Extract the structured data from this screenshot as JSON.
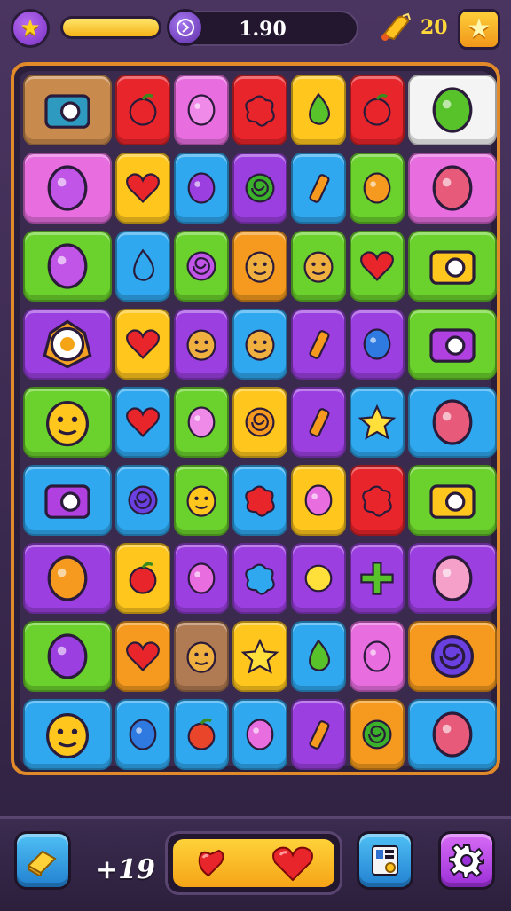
{
  "hud": {
    "score": "1.90",
    "lives": "20",
    "level_icon": "star-icon",
    "settings_icon": "gear-icon"
  },
  "bottom": {
    "moves": "19",
    "booster_icon": "eraser-icon",
    "map_icon": "map-icon",
    "tray_items": [
      "heart-piece",
      "heart"
    ]
  },
  "colors": {
    "green": "#6bd12c",
    "red": "#e8252b",
    "pink": "#e86ee0",
    "yellow": "#ffc61e",
    "blue": "#2fa8f0",
    "purple": "#9b3fe0",
    "orange": "#f59a1e",
    "white": "#f4f4f4",
    "tan": "#c98a4e",
    "brown": "#b07a52"
  },
  "board": {
    "rows": [
      [
        {
          "color": "tan",
          "icon": "map"
        },
        {
          "color": "red",
          "icon": "apple"
        },
        {
          "color": "pink",
          "icon": "blob"
        },
        {
          "color": "red",
          "icon": "flower"
        },
        {
          "color": "yellow",
          "icon": "green-drop"
        },
        {
          "color": "red",
          "icon": "apple"
        },
        {
          "color": "white",
          "icon": "green-blobs"
        }
      ],
      [
        {
          "color": "pink",
          "icon": "creature"
        },
        {
          "color": "yellow",
          "icon": "heart"
        },
        {
          "color": "blue",
          "icon": "plum"
        },
        {
          "color": "purple",
          "icon": "green-swirl"
        },
        {
          "color": "blue",
          "icon": "crayon"
        },
        {
          "color": "green",
          "icon": "orange-bean"
        },
        {
          "color": "pink",
          "icon": "fish"
        }
      ],
      [
        {
          "color": "green",
          "icon": "creature"
        },
        {
          "color": "blue",
          "icon": "drop"
        },
        {
          "color": "green",
          "icon": "horseshoe"
        },
        {
          "color": "orange",
          "icon": "face"
        },
        {
          "color": "green",
          "icon": "face"
        },
        {
          "color": "green",
          "icon": "heart"
        },
        {
          "color": "green",
          "icon": "broom"
        }
      ],
      [
        {
          "color": "purple",
          "icon": "egg"
        },
        {
          "color": "yellow",
          "icon": "heart"
        },
        {
          "color": "purple",
          "icon": "ghost"
        },
        {
          "color": "blue",
          "icon": "ghost"
        },
        {
          "color": "purple",
          "icon": "crayon"
        },
        {
          "color": "purple",
          "icon": "squiggle"
        },
        {
          "color": "green",
          "icon": "box"
        }
      ],
      [
        {
          "color": "green",
          "icon": "cat"
        },
        {
          "color": "blue",
          "icon": "heart"
        },
        {
          "color": "green",
          "icon": "blob"
        },
        {
          "color": "yellow",
          "icon": "lollipop"
        },
        {
          "color": "purple",
          "icon": "crayon"
        },
        {
          "color": "blue",
          "icon": "star"
        },
        {
          "color": "blue",
          "icon": "fish"
        }
      ],
      [
        {
          "color": "blue",
          "icon": "camera"
        },
        {
          "color": "blue",
          "icon": "spiral"
        },
        {
          "color": "green",
          "icon": "bird"
        },
        {
          "color": "blue",
          "icon": "flower"
        },
        {
          "color": "yellow",
          "icon": "bean"
        },
        {
          "color": "red",
          "icon": "flower"
        },
        {
          "color": "green",
          "icon": "cheese"
        }
      ],
      [
        {
          "color": "purple",
          "icon": "fruits"
        },
        {
          "color": "yellow",
          "icon": "apple"
        },
        {
          "color": "purple",
          "icon": "bean"
        },
        {
          "color": "purple",
          "icon": "splat"
        },
        {
          "color": "purple",
          "icon": "dot"
        },
        {
          "color": "purple",
          "icon": "cross"
        },
        {
          "color": "purple",
          "icon": "angel"
        }
      ],
      [
        {
          "color": "green",
          "icon": "candy"
        },
        {
          "color": "orange",
          "icon": "heart"
        },
        {
          "color": "brown",
          "icon": "face"
        },
        {
          "color": "yellow",
          "icon": "star"
        },
        {
          "color": "blue",
          "icon": "leaf"
        },
        {
          "color": "pink",
          "icon": "bean"
        },
        {
          "color": "orange",
          "icon": "spiral"
        }
      ],
      [
        {
          "color": "blue",
          "icon": "bird"
        },
        {
          "color": "blue",
          "icon": "squiggle"
        },
        {
          "color": "blue",
          "icon": "tomato"
        },
        {
          "color": "blue",
          "icon": "bean"
        },
        {
          "color": "purple",
          "icon": "crayon"
        },
        {
          "color": "orange",
          "icon": "green-swirl"
        },
        {
          "color": "blue",
          "icon": "fish"
        }
      ]
    ]
  }
}
